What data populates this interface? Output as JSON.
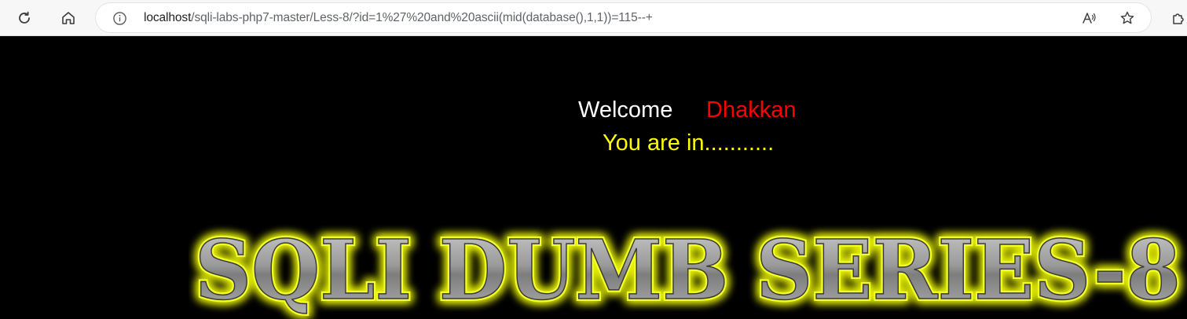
{
  "browser": {
    "url_host": "localhost",
    "url_path": "/sqli-labs-php7-master/Less-8/?id=1%27%20and%20ascii(mid(database(),1,1))=115--+",
    "icons": [
      "refresh-icon",
      "home-icon",
      "info-icon",
      "read-aloud-icon",
      "favorite-star-icon",
      "extensions-icon"
    ]
  },
  "page": {
    "welcome_label": "Welcome",
    "welcome_name": "Dhakkan",
    "status_message": "You are in...........",
    "banner_text": "SQLI DUMB SERIES-8",
    "colors": {
      "background": "#000000",
      "welcome": "#ffffff",
      "name": "#ff0000",
      "status": "#ffff00",
      "banner_glow": "#e5f000",
      "banner_fill": "#9a9a9a"
    }
  }
}
